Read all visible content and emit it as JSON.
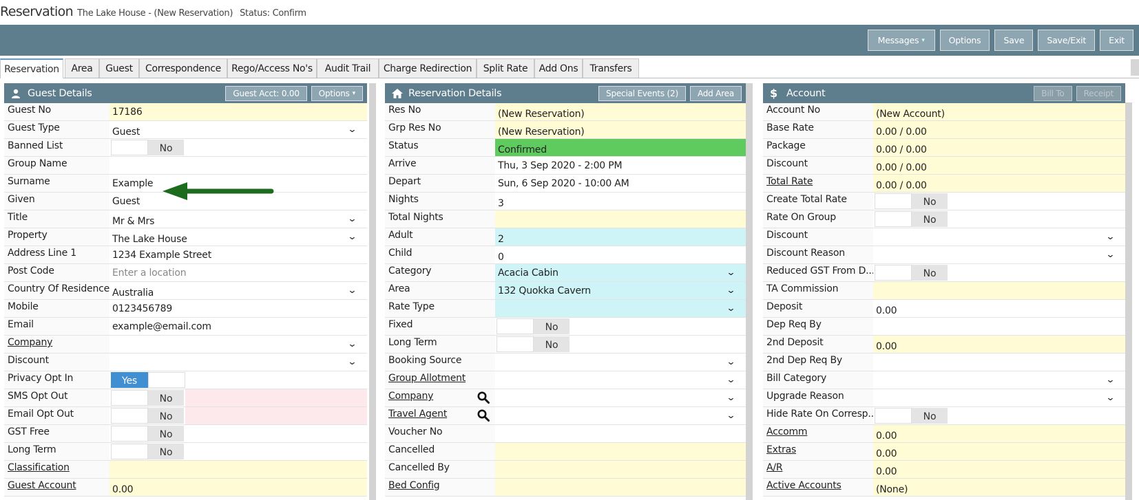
{
  "title": {
    "main": "Reservation",
    "sub": "The Lake House - (New Reservation)",
    "status": "Status: Confirm"
  },
  "toolbar": {
    "messages": "Messages",
    "options": "Options",
    "save": "Save",
    "save_exit": "Save/Exit",
    "exit": "Exit"
  },
  "tabs": [
    "Reservation",
    "Area",
    "Guest",
    "Correspondence",
    "Rego/Access No's",
    "Audit Trail",
    "Charge Redirection",
    "Split Rate",
    "Add Ons",
    "Transfers"
  ],
  "guest": {
    "title": "Guest Details",
    "btn_acct": "Guest Acct: 0.00",
    "btn_options": "Options",
    "rows": [
      {
        "label": "Guest No",
        "value": "17186"
      },
      {
        "label": "Guest Type",
        "value": "Guest"
      },
      {
        "label": "Banned List",
        "value": "No"
      },
      {
        "label": "Group Name",
        "value": ""
      },
      {
        "label": "Surname",
        "value": "Example"
      },
      {
        "label": "Given",
        "value": "Guest"
      },
      {
        "label": "Title",
        "value": "Mr & Mrs"
      },
      {
        "label": "Property",
        "value": "The Lake House"
      },
      {
        "label": "Address Line 1",
        "value": "1234 Example Street"
      },
      {
        "label": "Post Code",
        "placeholder": "Enter a location"
      },
      {
        "label": "Country Of Residence",
        "value": "Australia"
      },
      {
        "label": "Mobile",
        "value": "0123456789"
      },
      {
        "label": "Email",
        "value": "example@email.com"
      },
      {
        "label": "Company",
        "value": ""
      },
      {
        "label": "Discount",
        "value": ""
      },
      {
        "label": "Privacy Opt In",
        "value": "Yes"
      },
      {
        "label": "SMS Opt Out",
        "value": "No"
      },
      {
        "label": "Email Opt Out",
        "value": "No"
      },
      {
        "label": "GST Free",
        "value": "No"
      },
      {
        "label": "Long Term",
        "value": "No"
      },
      {
        "label": "Classification",
        "value": ""
      },
      {
        "label": "Guest Account",
        "value": "0.00"
      }
    ]
  },
  "reservation": {
    "title": "Reservation Details",
    "btn_events": "Special Events (2)",
    "btn_area": "Add Area",
    "rows": [
      {
        "label": "Res No",
        "value": "(New Reservation)"
      },
      {
        "label": "Grp Res No",
        "value": "(New Reservation)"
      },
      {
        "label": "Status",
        "value": "Confirmed"
      },
      {
        "label": "Arrive",
        "value": "Thu, 3 Sep 2020 - 2:00 PM"
      },
      {
        "label": "Depart",
        "value": "Sun, 6 Sep 2020 - 10:00 AM"
      },
      {
        "label": "Nights",
        "value": "3"
      },
      {
        "label": "Total Nights",
        "value": ""
      },
      {
        "label": "Adult",
        "value": "2"
      },
      {
        "label": "Child",
        "value": "0"
      },
      {
        "label": "Category",
        "value": "Acacia Cabin"
      },
      {
        "label": "Area",
        "value": "132 Quokka Cavern"
      },
      {
        "label": "Rate Type",
        "value": ""
      },
      {
        "label": "Fixed",
        "value": "No"
      },
      {
        "label": "Long Term",
        "value": "No"
      },
      {
        "label": "Booking Source",
        "value": ""
      },
      {
        "label": "Group Allotment",
        "value": ""
      },
      {
        "label": "Company",
        "value": ""
      },
      {
        "label": "Travel Agent",
        "value": ""
      },
      {
        "label": "Voucher No",
        "value": ""
      },
      {
        "label": "Cancelled",
        "value": ""
      },
      {
        "label": "Cancelled By",
        "value": ""
      },
      {
        "label": "Bed Config",
        "value": ""
      }
    ]
  },
  "account": {
    "title": "Account",
    "btn_billto": "Bill To",
    "btn_receipt": "Receipt",
    "rows": [
      {
        "label": "Account No",
        "value": "(New Account)"
      },
      {
        "label": "Base Rate",
        "value": "0.00 / 0.00"
      },
      {
        "label": "Package",
        "value": "0.00 / 0.00"
      },
      {
        "label": "Discount",
        "value": "0.00 / 0.00"
      },
      {
        "label": "Total Rate",
        "value": "0.00 / 0.00"
      },
      {
        "label": "Create Total Rate",
        "value": "No"
      },
      {
        "label": "Rate On Group",
        "value": "No"
      },
      {
        "label": "Discount",
        "value": ""
      },
      {
        "label": "Discount Reason",
        "value": ""
      },
      {
        "label": "Reduced GST From D...",
        "value": "No"
      },
      {
        "label": "TA Commission",
        "value": ""
      },
      {
        "label": "Deposit",
        "value": "0.00"
      },
      {
        "label": "Dep Req By",
        "value": ""
      },
      {
        "label": "2nd Deposit",
        "value": "0.00"
      },
      {
        "label": "2nd Dep Req By",
        "value": ""
      },
      {
        "label": "Bill Category",
        "value": ""
      },
      {
        "label": "Upgrade Reason",
        "value": ""
      },
      {
        "label": "Hide Rate On Corresp...",
        "value": "No"
      },
      {
        "label": "Accomm",
        "value": "0.00"
      },
      {
        "label": "Extras",
        "value": "0.00"
      },
      {
        "label": "A/R",
        "value": "0.00"
      },
      {
        "label": "Active Accounts",
        "value": "(None)"
      }
    ]
  },
  "colors": {
    "header": "#5e7e8e",
    "highlight_yellow": "#fffbd4",
    "status_green": "#5fcb5f",
    "cyan": "#cff4f7",
    "toggle_yes": "#3f8fd2",
    "arrow": "#1d6b1d"
  }
}
